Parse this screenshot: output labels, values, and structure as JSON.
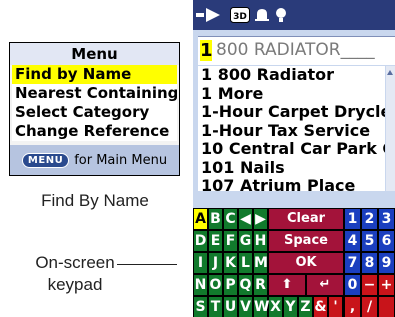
{
  "menu": {
    "title": "Menu",
    "items": [
      {
        "label": "Find by Name",
        "selected": true
      },
      {
        "label": "Nearest Containing...",
        "selected": false
      },
      {
        "label": "Select Category",
        "selected": false
      },
      {
        "label": "Change Reference",
        "selected": false
      }
    ],
    "footer_button": "MENU",
    "footer_text": "for Main Menu"
  },
  "captions": {
    "find_by_name": "Find By Name",
    "keypad_line1": "On-screen",
    "keypad_line2": "keypad"
  },
  "device": {
    "status_icons": [
      "arrow-icon",
      "3d-map-icon",
      "bell-icon",
      "lightbulb-icon"
    ],
    "search_cursor": "1",
    "search_text": "800 RADIATOR____",
    "results": [
      "1 800 Radiator",
      "1 More",
      "1-Hour Carpet Dryclea",
      "1-Hour Tax Service",
      "10 Central Car Park G",
      "101 Nails",
      "107 Atrium Place"
    ],
    "keypad": {
      "row1_letters": [
        "A",
        "B",
        "C"
      ],
      "row1_arrows": [
        "◀",
        "▶"
      ],
      "row1_ctrl": "Clear",
      "row1_nums": [
        "1",
        "2",
        "3"
      ],
      "row2_letters": [
        "D",
        "E",
        "F",
        "G",
        "H"
      ],
      "row2_ctrl": "Space",
      "row2_nums": [
        "4",
        "5",
        "6"
      ],
      "row3_letters": [
        "I",
        "J",
        "K",
        "L",
        "M"
      ],
      "row3_ctrl": "OK",
      "row3_nums": [
        "7",
        "8",
        "9"
      ],
      "row4_letters": [
        "N",
        "O",
        "P",
        "Q",
        "R"
      ],
      "row4_ctrl": [
        "⬆",
        "↵"
      ],
      "row4_nums": [
        "0",
        "−",
        "+"
      ],
      "row5_letters": [
        "S",
        "T",
        "U",
        "V",
        "W",
        "X",
        "Y",
        "Z"
      ],
      "row5_sym": [
        "&",
        "'",
        ",",
        "/"
      ]
    },
    "colors": {
      "letter_key": "#117a2c",
      "selected_key": "#ffff00",
      "control_key": "#a3133a",
      "number_key": "#1b3fbf",
      "screen_bg": "#c9d7ee",
      "status_bar": "#2a3b7a"
    }
  }
}
